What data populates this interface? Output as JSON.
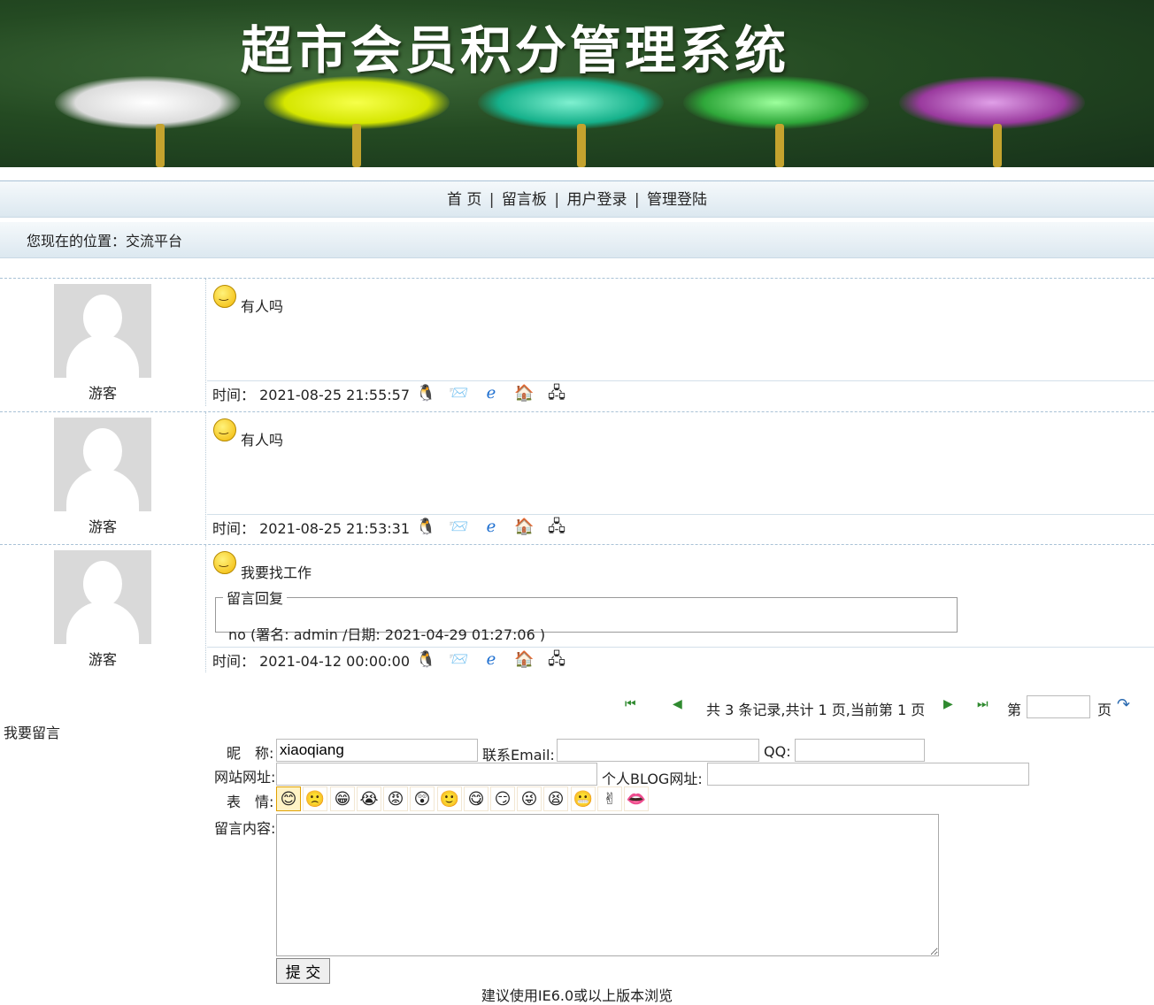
{
  "banner": {
    "title": "超市会员积分管理系统"
  },
  "nav": {
    "items": [
      "首 页",
      "留言板",
      "用户登录",
      "管理登陆"
    ],
    "separator": "|"
  },
  "location": {
    "text": "您现在的位置：交流平台"
  },
  "messages": [
    {
      "author": "游客",
      "content": "有人吗",
      "time_label": "时间：",
      "time": "2021-08-25 21:55:57"
    },
    {
      "author": "游客",
      "content": "有人吗",
      "time_label": "时间：",
      "time": "2021-08-25 21:53:31"
    },
    {
      "author": "游客",
      "content": "我要找工作",
      "time_label": "时间：",
      "time": "2021-04-12 00:00:00",
      "reply": {
        "legend": "留言回复",
        "text": "no (署名: admin /日期: 2021-04-29 01:27:06 )"
      }
    }
  ],
  "pager": {
    "summary": "共 3 条记录,共计 1 页,当前第 1 页",
    "goto_prefix": "第",
    "goto_suffix": "页",
    "page_input": ""
  },
  "form": {
    "heading": "我要留言",
    "nickname_label": "昵　称:",
    "nickname_value": "xiaoqiang",
    "email_label": "联系Email:",
    "email_value": "",
    "qq_label": "QQ:",
    "qq_value": "",
    "website_label": "网站网址:",
    "website_value": "",
    "blog_label": "个人BLOG网址:",
    "blog_value": "",
    "face_label": "表　情:",
    "content_label": "留言内容:",
    "content_value": "",
    "submit_label": "提 交"
  },
  "faces": [
    "😊",
    "🙁",
    "😁",
    "😭",
    "😡",
    "😲",
    "🙂",
    "😋",
    "😏",
    "😜",
    "😫",
    "😬",
    "✌",
    "👄"
  ],
  "footer": {
    "text": "建议使用IE6.0或以上版本浏览"
  }
}
